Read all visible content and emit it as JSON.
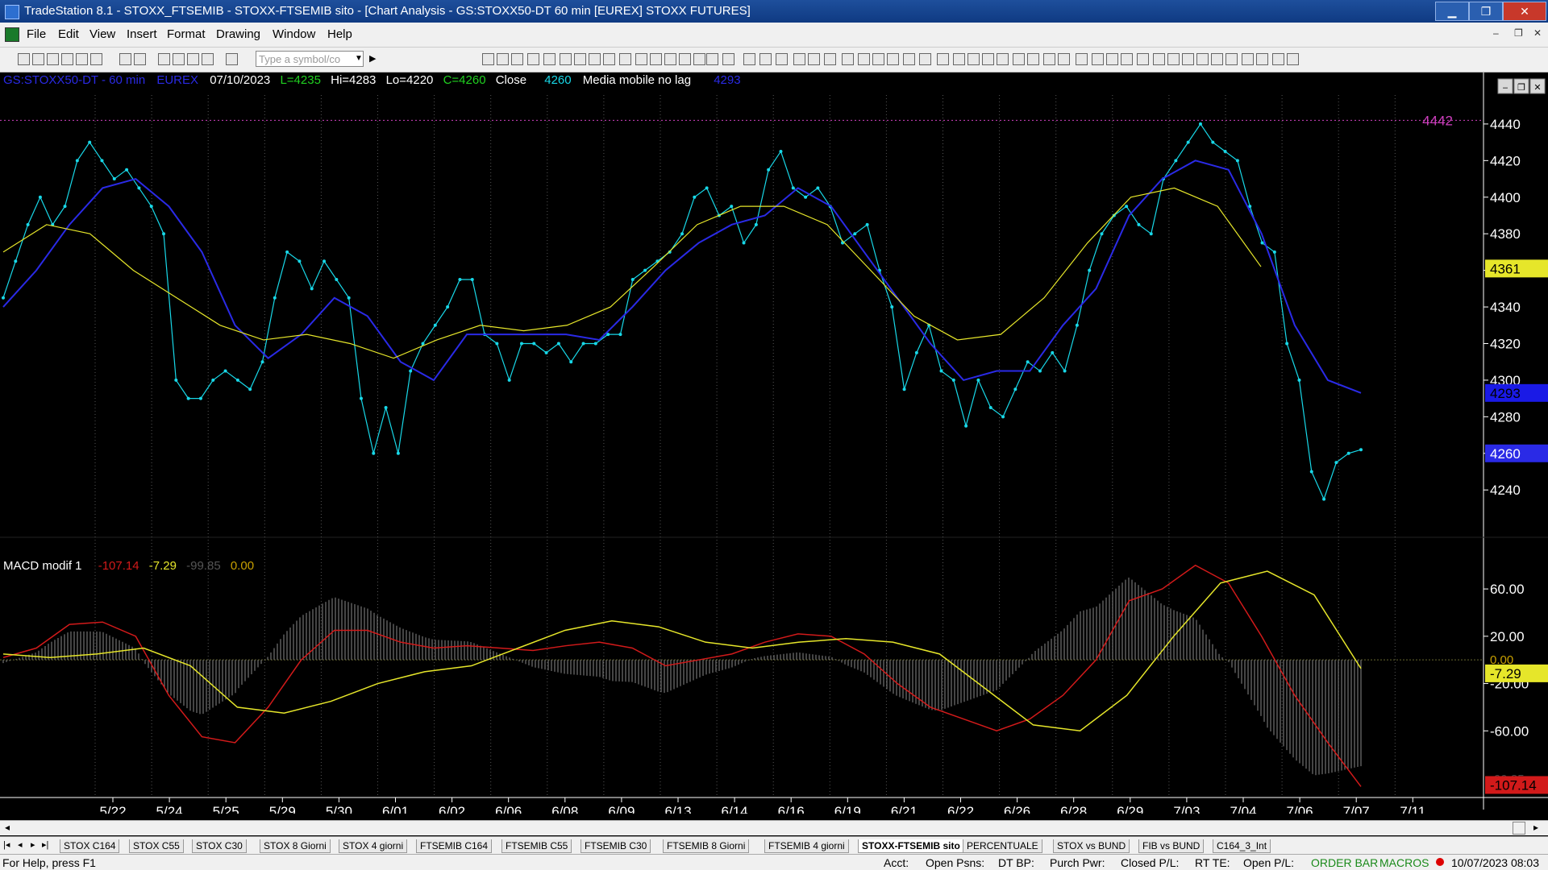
{
  "window": {
    "title": "TradeStation 8.1 - STOXX_FTSEMIB - STOXX-FTSEMIB sito - [Chart Analysis - GS:STOXX50-DT  60 min  [EUREX] STOXX FUTURES]",
    "minimize": "▁",
    "restore": "❐",
    "close": "✕"
  },
  "menu": [
    "File",
    "Edit",
    "View",
    "Insert",
    "Format",
    "Drawing",
    "Window",
    "Help"
  ],
  "toolbar": {
    "symbol_placeholder": "Type a symbol/co"
  },
  "legend": {
    "symbol": "GS:STOXX50-DT - 60 min",
    "exchange": "EUREX",
    "date": "07/10/2023",
    "last": "L=4235",
    "high": "Hi=4283",
    "low": "Lo=4220",
    "close": "C=4260",
    "close_label": "Close",
    "close_value": "4260",
    "indicator_name": "Media mobile no lag",
    "indicator_value": "4293"
  },
  "macd_legend": {
    "name": "MACD modif 1",
    "v1": "-107.14",
    "v2": "-7.29",
    "v3": "-99.85",
    "v4": "0.00"
  },
  "colors": {
    "price": "#18d8e8",
    "blue_ma": "#2a2ae6",
    "yellow_ma": "#e6e62a",
    "macd_red": "#d21a1a",
    "macd_yellow": "#e6e62a",
    "histogram": "#8a8a8a",
    "top_line": "#d040c0"
  },
  "chart_data": [
    {
      "type": "line",
      "title": "GS:STOXX50-DT - 60 min",
      "x_labels": [
        "5/22",
        "5/24",
        "5/25",
        "5/29",
        "5/30",
        "6/01",
        "6/02",
        "6/06",
        "6/08",
        "6/09",
        "6/13",
        "6/14",
        "6/16",
        "6/19",
        "6/21",
        "6/22",
        "6/26",
        "6/28",
        "6/29",
        "7/03",
        "7/04",
        "7/06",
        "7/07",
        "7/11"
      ],
      "y_ticks": [
        4440,
        4420,
        4400,
        4380,
        4360,
        4340,
        4320,
        4300,
        4280,
        4260,
        4240
      ],
      "ylim": [
        4215,
        4447
      ],
      "series": [
        {
          "name": "Close",
          "values": [
            4345,
            4365,
            4385,
            4400,
            4385,
            4395,
            4420,
            4430,
            4420,
            4410,
            4415,
            4405,
            4395,
            4380,
            4300,
            4290,
            4290,
            4300,
            4305,
            4300,
            4295,
            4310,
            4345,
            4370,
            4365,
            4350,
            4365,
            4355,
            4345,
            4290,
            4260,
            4285,
            4260,
            4305,
            4320,
            4330,
            4340,
            4355,
            4355,
            4325,
            4320,
            4300,
            4320,
            4320,
            4315,
            4320,
            4310,
            4320,
            4320,
            4325,
            4325,
            4355,
            4360,
            4365,
            4370,
            4380,
            4400,
            4405,
            4390,
            4395,
            4375,
            4385,
            4415,
            4425,
            4405,
            4400,
            4405,
            4395,
            4375,
            4380,
            4385,
            4360,
            4340,
            4295,
            4315,
            4330,
            4305,
            4300,
            4275,
            4300,
            4285,
            4280,
            4295,
            4310,
            4305,
            4315,
            4305,
            4330,
            4360,
            4380,
            4390,
            4395,
            4385,
            4380,
            4410,
            4420,
            4430,
            4440,
            4430,
            4425,
            4420,
            4395,
            4375,
            4370,
            4320,
            4300,
            4250,
            4235,
            4255,
            4260,
            4262
          ]
        },
        {
          "name": "Media mobile no lag",
          "values": [
            4340,
            4360,
            4385,
            4405,
            4410,
            4395,
            4370,
            4330,
            4312,
            4325,
            4345,
            4335,
            4310,
            4300,
            4325,
            4325,
            4325,
            4325,
            4322,
            4340,
            4360,
            4375,
            4385,
            4390,
            4405,
            4395,
            4370,
            4345,
            4320,
            4300,
            4305,
            4305,
            4330,
            4350,
            4390,
            4410,
            4420,
            4415,
            4380,
            4330,
            4300,
            4293
          ]
        },
        {
          "name": "Media mobile no lag",
          "values": [
            4370,
            4385,
            4380,
            4360,
            4345,
            4330,
            4322,
            4325,
            4320,
            4312,
            4322,
            4330,
            4327,
            4330,
            4340,
            4362,
            4385,
            4395,
            4395,
            4385,
            4360,
            4335,
            4322,
            4325,
            4345,
            4375,
            4400,
            4405,
            4395,
            4362
          ]
        }
      ]
    },
    {
      "type": "line",
      "title": "MACD modif 1",
      "y_ticks": [
        60,
        20,
        -20,
        -60
      ],
      "ylim": [
        -115,
        88
      ],
      "series": [
        {
          "name": "MACD",
          "values": [
            2,
            10,
            30,
            32,
            20,
            -30,
            -65,
            -70,
            -40,
            0,
            25,
            25,
            15,
            10,
            12,
            10,
            8,
            12,
            15,
            10,
            -5,
            0,
            5,
            15,
            22,
            20,
            5,
            -20,
            -40,
            -50,
            -60,
            -50,
            -30,
            0,
            50,
            60,
            80,
            65,
            20,
            -30,
            -70,
            -107.14
          ]
        },
        {
          "name": "Signal",
          "values": [
            5,
            2,
            5,
            10,
            -5,
            -40,
            -45,
            -35,
            -20,
            -10,
            -5,
            10,
            25,
            33,
            28,
            15,
            10,
            15,
            18,
            15,
            5,
            -25,
            -55,
            -60,
            -30,
            20,
            65,
            75,
            55,
            -7.29
          ]
        }
      ]
    }
  ],
  "price_axis_labels": {
    "top_value": "4442",
    "yellow_label": "4361",
    "blue_label": "4293",
    "close_label": "4260"
  },
  "macd_axis_labels": {
    "zero_label": "0.00",
    "signal_label": "-7.29",
    "bottom_label": "-107.14",
    "faded_label": "-99.85"
  },
  "sheet_tabs": [
    "STOX C164",
    "STOX C55",
    "STOX  C30",
    "STOX  8 Giorni",
    "STOX 4 giorni",
    "FTSEMIB C164",
    "FTSEMIB C55",
    "FTSEMIB C30",
    "FTSEMIB  8 Giorni",
    "FTSEMIB  4 giorni",
    "STOXX-FTSEMIB sito",
    "PERCENTUALE",
    "STOX vs BUND",
    "FIB vs BUND",
    "C164_3_Int"
  ],
  "active_tab": "STOXX-FTSEMIB sito",
  "status": {
    "help": "For Help, press F1",
    "acct": "Acct:",
    "open_psns": "Open Psns:",
    "dt_bp": "DT BP:",
    "purch_pwr": "Purch Pwr:",
    "closed_pl": "Closed P/L:",
    "rt_te": "RT TE:",
    "open_pl": "Open P/L:",
    "order_bar": "ORDER BAR",
    "macros": "MACROS",
    "datetime": "10/07/2023 08:03"
  }
}
